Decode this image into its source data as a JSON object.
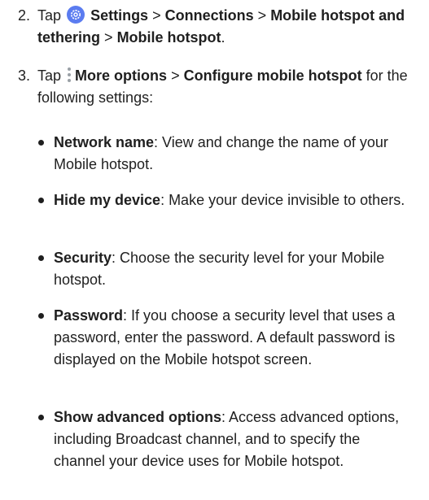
{
  "step2": {
    "number": "2.",
    "tap": "Tap",
    "settings_icon": "settings-gear-icon",
    "path1": "Settings",
    "sep": ">",
    "path2": "Connections",
    "path3": "Mobile hotspot and tethering",
    "path4": "Mobile hotspot",
    "end": "."
  },
  "step3": {
    "number": "3.",
    "tap": "Tap",
    "more_icon": "more-options-icon",
    "more": "More options",
    "sep": ">",
    "configure": "Configure mobile hotspot",
    "tail": "for the following settings:"
  },
  "bullets": [
    {
      "term": "Network name",
      "text": ": View and change the name of your Mobile hotspot."
    },
    {
      "term": "Hide my device",
      "text": ": Make your device invisible to others."
    },
    {
      "term": "Security",
      "text": ": Choose the security level for your Mobile hotspot."
    },
    {
      "term": "Password",
      "text": ": If you choose a security level that uses a password, enter the password. A default password is displayed on the Mobile hotspot screen."
    },
    {
      "term": "Show advanced options",
      "text": ": Access advanced options, including Broadcast channel, and to specify the channel your device uses for Mobile hotspot."
    }
  ],
  "colors": {
    "settings_icon": "#5b7cf0",
    "more_icon": "#9aa0a6"
  }
}
